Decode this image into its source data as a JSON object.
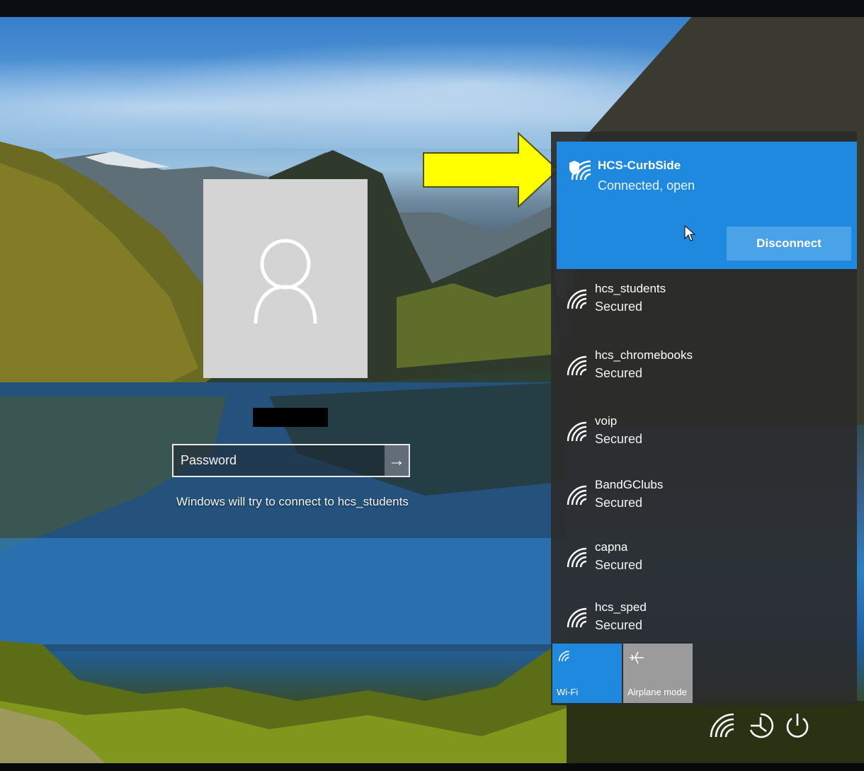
{
  "login": {
    "password_placeholder": "Password",
    "submit_glyph": "→",
    "connect_hint": "Windows will try to connect to hcs_students"
  },
  "network_flyout": {
    "connected": {
      "name": "HCS-CurbSide",
      "status": "Connected, open",
      "disconnect_label": "Disconnect",
      "icon": "wifi-shield-icon"
    },
    "networks": [
      {
        "name": "hcs_students",
        "status": "Secured",
        "icon": "wifi-icon"
      },
      {
        "name": "hcs_chromebooks",
        "status": "Secured",
        "icon": "wifi-icon"
      },
      {
        "name": "voip",
        "status": "Secured",
        "icon": "wifi-icon"
      },
      {
        "name": "BandGClubs",
        "status": "Secured",
        "icon": "wifi-icon"
      },
      {
        "name": "capna",
        "status": "Secured",
        "icon": "wifi-icon"
      },
      {
        "name": "hcs_sped",
        "status": "Secured",
        "icon": "wifi-icon"
      }
    ],
    "quick_actions": [
      {
        "label": "Wi-Fi",
        "icon": "wifi-icon",
        "active": true
      },
      {
        "label": "Airplane mode",
        "icon": "airplane-icon",
        "active": false
      }
    ]
  },
  "tray": {
    "icons": [
      "wifi-icon",
      "ease-of-access-icon",
      "power-icon"
    ]
  },
  "colors": {
    "accent": "#1f89e0",
    "flyout_bg": "#2b2b2b",
    "arrow": "#ffff00"
  }
}
